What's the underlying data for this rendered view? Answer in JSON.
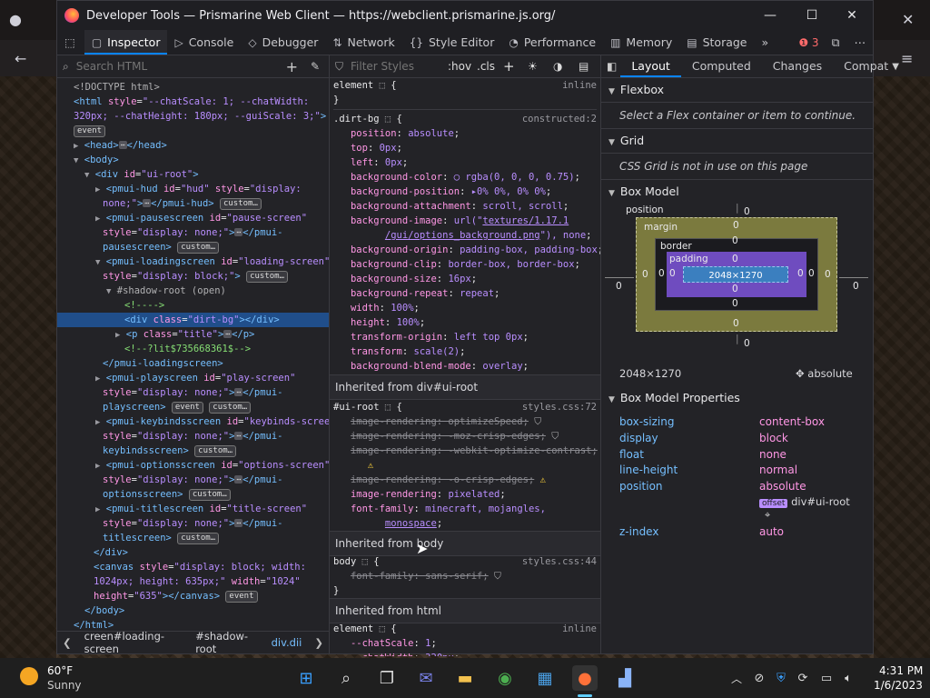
{
  "window": {
    "title": "Developer Tools — Prismarine Web Client — https://webclient.prismarine.js.org/",
    "minimize": "—",
    "maximize": "☐",
    "close": "✕"
  },
  "toolbar": {
    "tabs": [
      {
        "label": "Inspector",
        "icon": "▢"
      },
      {
        "label": "Console",
        "icon": "▷"
      },
      {
        "label": "Debugger",
        "icon": "◇"
      },
      {
        "label": "Network",
        "icon": "⇅"
      },
      {
        "label": "Style Editor",
        "icon": "{}"
      },
      {
        "label": "Performance",
        "icon": "◔"
      },
      {
        "label": "Memory",
        "icon": "▥"
      },
      {
        "label": "Storage",
        "icon": "▤"
      }
    ],
    "more": "»",
    "error_count": "3"
  },
  "inspector": {
    "search_placeholder": "Search HTML",
    "breadcrumbs": [
      "creen#loading-screen",
      "#shadow-root",
      "div.dii"
    ]
  },
  "rules": {
    "filter_placeholder": "Filter Styles",
    "hov": ":hov",
    "cls": ".cls",
    "element_inline": "inline",
    "dirt_source": "constructed:2",
    "inherited_ui_root": "Inherited from div#ui-root",
    "ui_root_source": "styles.css:72",
    "inherited_body": "Inherited from body",
    "body_source": "styles.css:44",
    "inherited_html": "Inherited from html",
    "html_source": "inline"
  },
  "layout": {
    "tabs": [
      "Layout",
      "Computed",
      "Changes",
      "Compat"
    ],
    "flexbox": "Flexbox",
    "flex_hint": "Select a Flex container or item to continue.",
    "grid": "Grid",
    "grid_hint": "CSS Grid is not in use on this page",
    "box_model": "Box Model",
    "position_label": "position",
    "margin_label": "margin",
    "border_label": "border",
    "padding_label": "padding",
    "content_size": "2048×1270",
    "size_readout": "2048×1270",
    "position_readout": "absolute",
    "zero": "0",
    "properties_title": "Box Model Properties",
    "properties": [
      {
        "k": "box-sizing",
        "v": "content-box"
      },
      {
        "k": "display",
        "v": "block"
      },
      {
        "k": "float",
        "v": "none"
      },
      {
        "k": "line-height",
        "v": "normal"
      },
      {
        "k": "position",
        "v": "absolute"
      },
      {
        "k": "z-index",
        "v": "auto"
      }
    ],
    "offset_badge": "offset",
    "offset_target": "div#ui-root"
  },
  "taskbar": {
    "weather_temp": "60°F",
    "weather_desc": "Sunny",
    "time": "4:31 PM",
    "date": "1/6/2023"
  }
}
